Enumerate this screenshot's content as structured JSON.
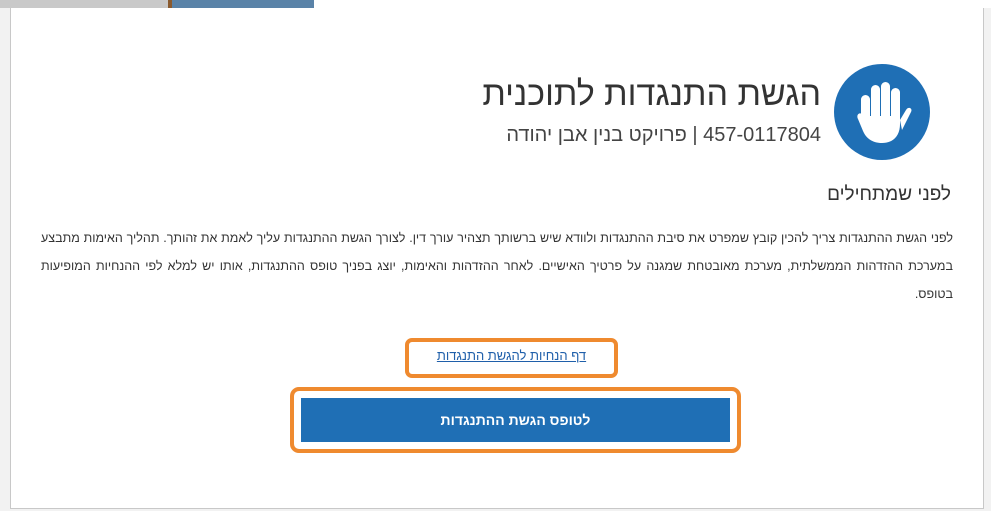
{
  "header": {
    "title": "הגשת התנגדות לתוכנית",
    "subtitle": "457-0117804 | פרויקט בנין אבן יהודה",
    "icon": "hand-stop-icon",
    "accent_color": "#1f6fb5"
  },
  "intro": {
    "heading": "לפני שמתחילים",
    "body": "לפני הגשת ההתנגדות צריך להכין קובץ שמפרט את סיבת ההתנגדות ולוודא שיש ברשותך תצהיר עורך דין. לצורך הגשת ההתנגדות עליך לאמת את זהותך. תהליך האימות מתבצע במערכת ההזדהות הממשלתית, מערכת מאובטחת שמגנה על פרטיך האישיים. לאחר ההזדהות והאימות, יוצג בפניך טופס ההתנגדות, אותו יש למלא לפי ההנחיות המופיעות בטופס."
  },
  "actions": {
    "guide_link": "דף הנחיות להגשת התנגדות",
    "submit_button": "לטופס הגשת ההתנגדות",
    "highlight_color": "#ef8a2f"
  }
}
